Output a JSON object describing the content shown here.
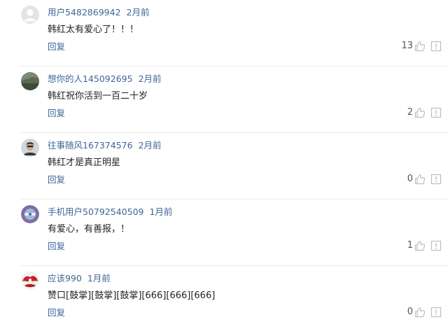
{
  "comments": [
    {
      "username": "用户5482869942",
      "time": "2月前",
      "text": "韩红太有爱心了！！！",
      "reply_label": "回复",
      "likes": "13",
      "avatar_icon": "default-user-avatar-icon"
    },
    {
      "username": "想你的人145092695",
      "time": "2月前",
      "text": "韩红祝你活到一百二十岁",
      "reply_label": "回复",
      "likes": "2",
      "avatar_icon": "landscape-photo-avatar-icon"
    },
    {
      "username": "往事随风167374576",
      "time": "2月前",
      "text": "韩红才是真正明星",
      "reply_label": "回复",
      "likes": "0",
      "avatar_icon": "portrait-photo-avatar-icon"
    },
    {
      "username": "手机用户50792540509",
      "time": "1月前",
      "text": "有爱心，有善报，！",
      "reply_label": "回复",
      "likes": "1",
      "avatar_icon": "purple-cartoon-avatar-icon"
    },
    {
      "username": "应该990",
      "time": "1月前",
      "text": "赞口[鼓掌][鼓掌][鼓掌][666][666][666]",
      "reply_label": "回复",
      "likes": "0",
      "avatar_icon": "red-white-avatar-icon"
    }
  ],
  "colors": {
    "username": "#406599",
    "reply": "#406599",
    "icon": "#bdbdbd",
    "divider": "#ececec"
  }
}
